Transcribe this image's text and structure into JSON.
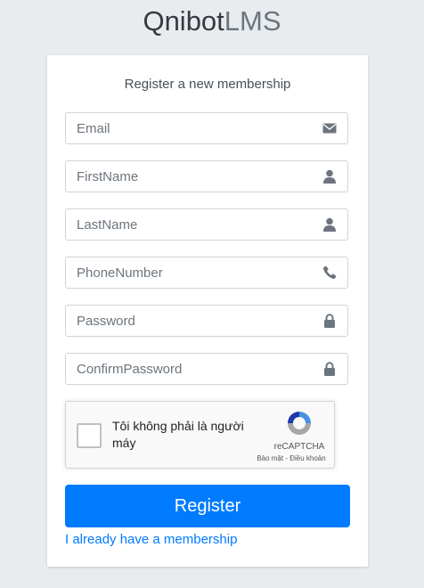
{
  "brand": {
    "bold": "Qnibot",
    "thin": "LMS"
  },
  "form": {
    "message": "Register a new membership",
    "fields": [
      {
        "placeholder": "Email",
        "icon": "envelope-icon"
      },
      {
        "placeholder": "FirstName",
        "icon": "user-icon"
      },
      {
        "placeholder": "LastName",
        "icon": "user-icon"
      },
      {
        "placeholder": "PhoneNumber",
        "icon": "phone-icon"
      },
      {
        "placeholder": "Password",
        "icon": "lock-icon"
      },
      {
        "placeholder": "ConfirmPassword",
        "icon": "lock-icon"
      }
    ],
    "captcha": {
      "label": "Tôi không phải là người máy",
      "brand": "reCAPTCHA",
      "terms": "Bảo mật - Điều khoản"
    },
    "submit_label": "Register",
    "login_link": "I already have a membership"
  },
  "colors": {
    "primary": "#007bff",
    "background": "#e9ecef",
    "icon": "#6c757d"
  }
}
